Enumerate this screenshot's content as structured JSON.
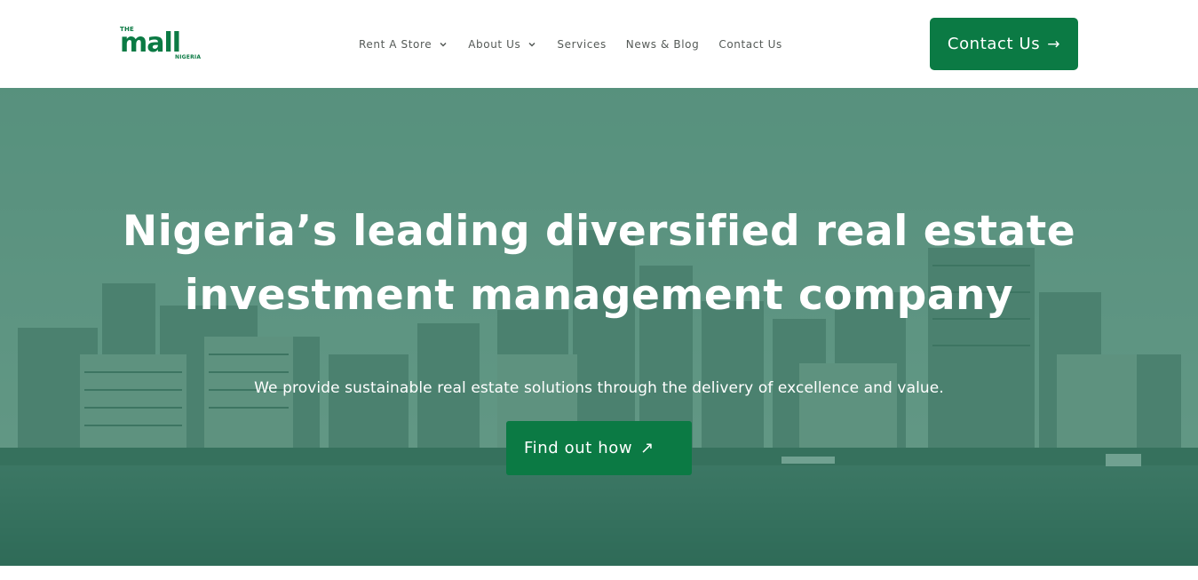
{
  "brand": {
    "logo_top": "THE",
    "logo_main": "mall",
    "logo_sub": "NIGERIA",
    "color": "#0b7a44"
  },
  "nav": {
    "items": [
      {
        "label": "Rent A Store",
        "has_dropdown": true
      },
      {
        "label": "About Us",
        "has_dropdown": true
      },
      {
        "label": "Services",
        "has_dropdown": false
      },
      {
        "label": "News & Blog",
        "has_dropdown": false
      },
      {
        "label": "Contact Us",
        "has_dropdown": false
      }
    ]
  },
  "header_cta": {
    "label": "Contact Us",
    "arrow": "→"
  },
  "hero": {
    "headline_line1": "Nigeria’s leading diversified real estate",
    "headline_line2": "investment management company",
    "subtext": "We provide sustainable real estate solutions through the delivery of excellence and value.",
    "button_label": "Find out how",
    "button_arrow": "↗",
    "background": "city-skyline-waterfront-image",
    "overlay_color": "#146448"
  }
}
